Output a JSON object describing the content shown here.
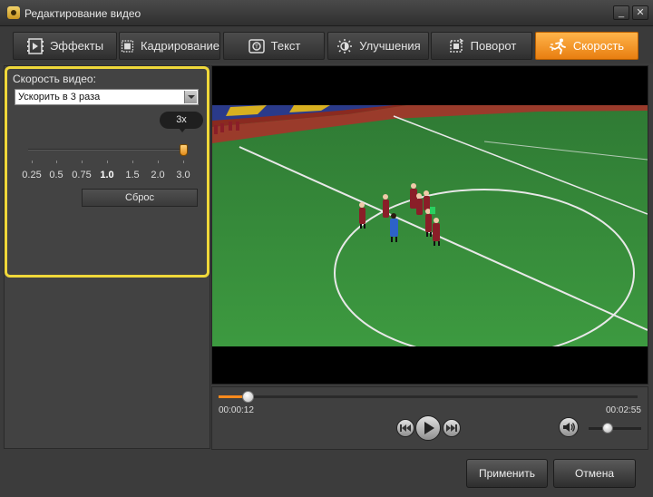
{
  "window": {
    "title": "Редактирование видео",
    "minimize_label": "_",
    "close_label": "✕"
  },
  "tabs": [
    {
      "label": "Эффекты",
      "icon": "effects-icon",
      "active": false
    },
    {
      "label": "Кадрирование",
      "icon": "crop-icon",
      "active": false
    },
    {
      "label": "Текст",
      "icon": "text-icon",
      "active": false
    },
    {
      "label": "Улучшения",
      "icon": "enhance-icon",
      "active": false
    },
    {
      "label": "Поворот",
      "icon": "rotate-icon",
      "active": false
    },
    {
      "label": "Скорость",
      "icon": "runner-icon",
      "active": true
    }
  ],
  "speed_panel": {
    "label": "Скорость видео:",
    "select_value": "Ускорить в 3 раза",
    "slider_value_label": "3x",
    "slider_value": 3.0,
    "ticks": [
      "0.25",
      "0.5",
      "0.75",
      "1.0",
      "1.5",
      "2.0",
      "3.0"
    ],
    "highlight_tick": "1.0",
    "reset_label": "Сброс",
    "highlight_color": "#f0d83a"
  },
  "player": {
    "current_time": "00:00:12",
    "total_time": "00:02:55",
    "progress_fraction": 0.07,
    "volume_fraction": 0.3,
    "buttons": [
      "rewind-icon",
      "play-icon",
      "fast-forward-icon",
      "volume-icon"
    ]
  },
  "footer": {
    "apply_label": "Применить",
    "cancel_label": "Отмена"
  },
  "colors": {
    "accent": "#ff8a1c",
    "active_tab": "#f59a2a"
  }
}
